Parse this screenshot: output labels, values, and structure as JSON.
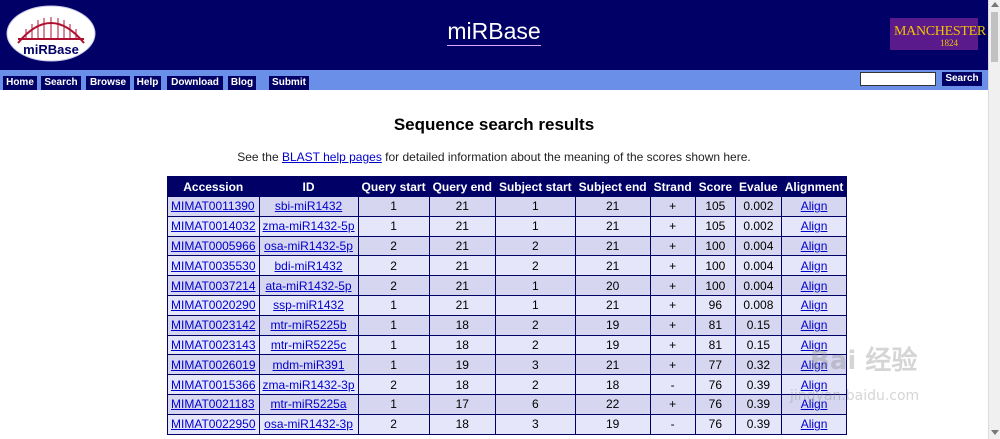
{
  "header": {
    "logo_text": "miRBase",
    "title": "miRBase",
    "partner_logo": {
      "name": "MANCHESTER",
      "year": "1824"
    }
  },
  "nav": {
    "items": [
      "Home",
      "Search",
      "Browse",
      "Help",
      "Download",
      "Blog",
      "Submit"
    ],
    "search_placeholder": "",
    "search_button": "Search"
  },
  "page": {
    "heading": "Sequence search results",
    "intro_prefix": "See the",
    "intro_link": "BLAST help pages",
    "intro_suffix": "for detailed information about the meaning of the scores shown here."
  },
  "table": {
    "columns": [
      "Accession",
      "ID",
      "Query start",
      "Query end",
      "Subject start",
      "Subject end",
      "Strand",
      "Score",
      "Evalue",
      "Alignment"
    ],
    "rows": [
      [
        "MIMAT0011390",
        "sbi-miR1432",
        "1",
        "21",
        "1",
        "21",
        "+",
        "105",
        "0.002",
        "Align"
      ],
      [
        "MIMAT0014032",
        "zma-miR1432-5p",
        "1",
        "21",
        "1",
        "21",
        "+",
        "105",
        "0.002",
        "Align"
      ],
      [
        "MIMAT0005966",
        "osa-miR1432-5p",
        "2",
        "21",
        "2",
        "21",
        "+",
        "100",
        "0.004",
        "Align"
      ],
      [
        "MIMAT0035530",
        "bdi-miR1432",
        "2",
        "21",
        "2",
        "21",
        "+",
        "100",
        "0.004",
        "Align"
      ],
      [
        "MIMAT0037214",
        "ata-miR1432-5p",
        "2",
        "21",
        "1",
        "20",
        "+",
        "100",
        "0.004",
        "Align"
      ],
      [
        "MIMAT0020290",
        "ssp-miR1432",
        "1",
        "21",
        "1",
        "21",
        "+",
        "96",
        "0.008",
        "Align"
      ],
      [
        "MIMAT0023142",
        "mtr-miR5225b",
        "1",
        "18",
        "2",
        "19",
        "+",
        "81",
        "0.15",
        "Align"
      ],
      [
        "MIMAT0023143",
        "mtr-miR5225c",
        "1",
        "18",
        "2",
        "19",
        "+",
        "81",
        "0.15",
        "Align"
      ],
      [
        "MIMAT0026019",
        "mdm-miR391",
        "1",
        "19",
        "3",
        "21",
        "+",
        "77",
        "0.32",
        "Align"
      ],
      [
        "MIMAT0015366",
        "zma-miR1432-3p",
        "2",
        "18",
        "2",
        "18",
        "-",
        "76",
        "0.39",
        "Align"
      ],
      [
        "MIMAT0021183",
        "mtr-miR5225a",
        "1",
        "17",
        "6",
        "22",
        "+",
        "76",
        "0.39",
        "Align"
      ],
      [
        "MIMAT0022950",
        "osa-miR1432-3p",
        "2",
        "18",
        "3",
        "19",
        "-",
        "76",
        "0.39",
        "Align"
      ]
    ]
  },
  "watermark": {
    "line1": "Bai 经验",
    "line2": "jingyan.baidu.com"
  },
  "colors": {
    "header_bg": "#000066",
    "nav_bar_bg": "#6a8fe8",
    "row_odd": "#d6d6f0",
    "row_even": "#e6e6fa",
    "link": "#0000cc"
  }
}
